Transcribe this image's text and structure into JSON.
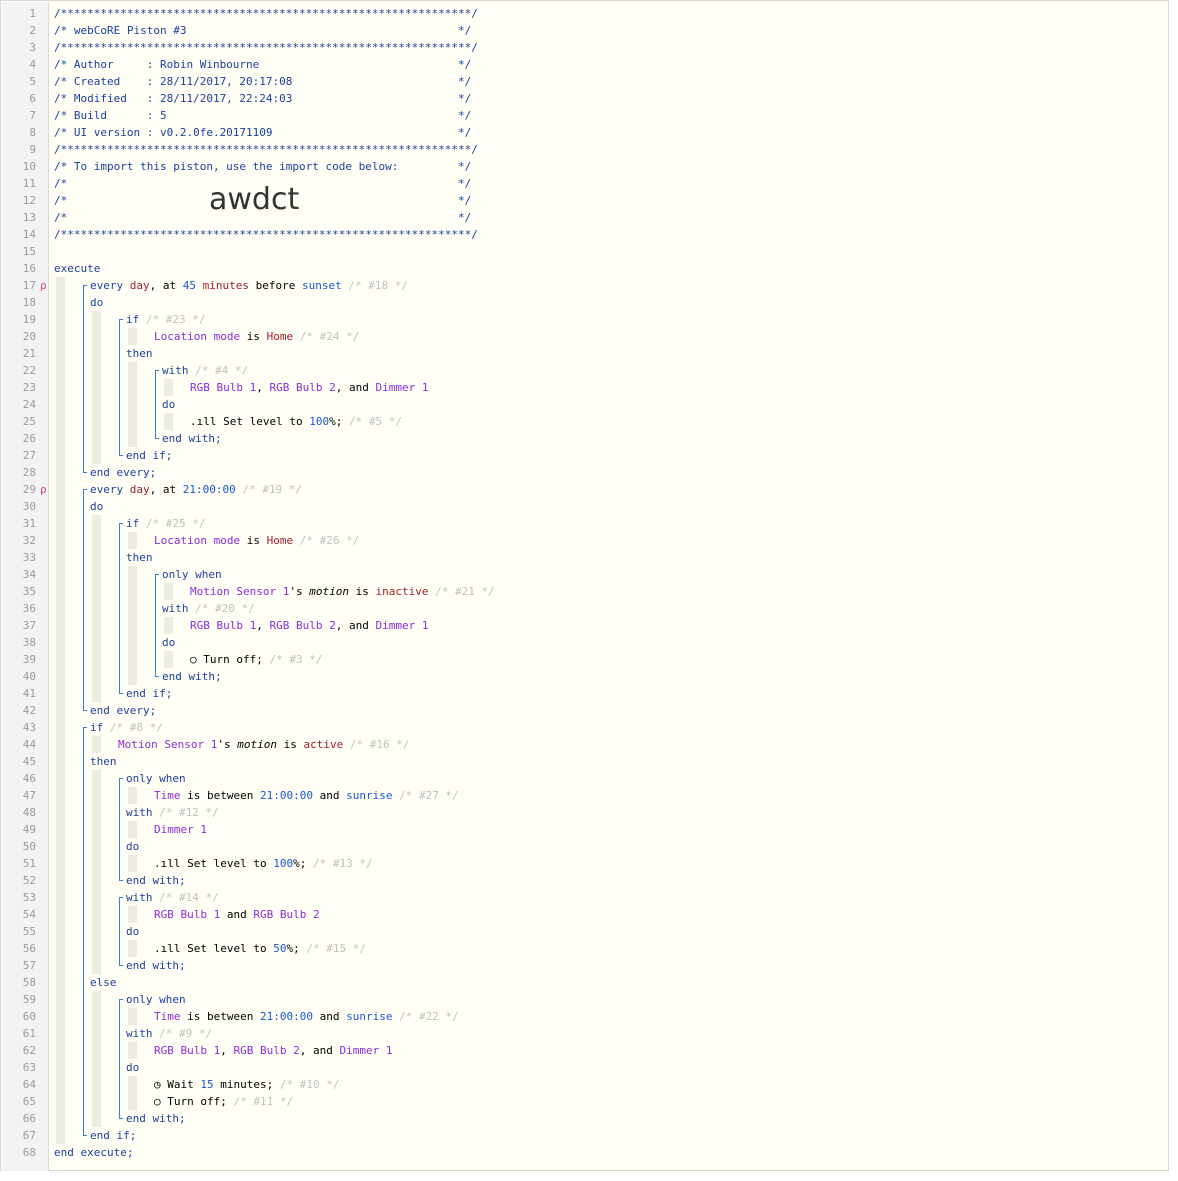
{
  "header": {
    "title": "webCoRE Piston #3",
    "author": "Robin Winbourne",
    "created": "28/11/2017, 20:17:08",
    "modified": "28/11/2017, 22:24:03",
    "build": "5",
    "ui_version": "v0.2.0fe.20171109",
    "import_text": "To import this piston, use the import code below:",
    "import_code": "awdct"
  },
  "code": {
    "execute": "execute",
    "end_execute": "end execute;",
    "every_day": "every",
    "day_word": "day",
    "at": "at",
    "offset_value": "45",
    "offset_unit": "minutes",
    "before": "before",
    "sunset": "sunset",
    "time_2100": "21:00:00",
    "sunrise": "sunrise",
    "location_mode": "Location mode",
    "home": "Home",
    "rgb_bulb_1": "RGB Bulb 1",
    "rgb_bulb_2": "RGB Bulb 2",
    "dimmer_1": "Dimmer 1",
    "motion_sensor_1": "Motion Sensor 1",
    "motion": "motion",
    "inactive": "inactive",
    "active": "active",
    "set_level": "Set level to",
    "level_100": "100",
    "level_50": "50",
    "turn_off": "Turn off;",
    "wait": "Wait",
    "wait_value": "15",
    "wait_unit": "minutes;",
    "time": "Time"
  },
  "line_numbers": 68,
  "colors": {
    "keyword": "#1c3fa0",
    "device": "#8a2be2",
    "value": "#1a56d8",
    "comment": "#c0c0c0",
    "string": "#a0202a",
    "pin": "#d4438a"
  }
}
